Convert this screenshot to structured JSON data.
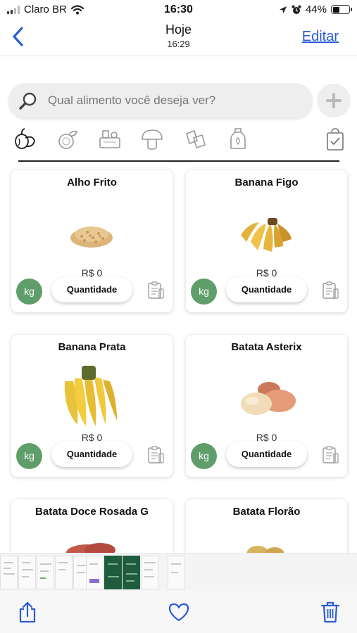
{
  "status_bar": {
    "carrier": "Claro BR",
    "time": "16:30",
    "battery": "44%",
    "battery_level": 0.44,
    "icons": [
      "signal-icon",
      "wifi-icon",
      "location-icon",
      "alarm-icon",
      "battery-icon"
    ]
  },
  "header": {
    "title": "Hoje",
    "subtitle": "16:29",
    "edit_label": "Editar",
    "accent": "#2a5bd7"
  },
  "search": {
    "placeholder": "Qual alimento você deseja ver?"
  },
  "categories": [
    {
      "icon": "vegetables-icon",
      "selected": true
    },
    {
      "icon": "fruits-icon",
      "selected": false
    },
    {
      "icon": "groceries-icon",
      "selected": false
    },
    {
      "icon": "mushroom-icon",
      "selected": false
    },
    {
      "icon": "packages-icon",
      "selected": false
    },
    {
      "icon": "bottle-icon",
      "selected": false
    },
    {
      "icon": "shopping-list-icon",
      "selected": false
    }
  ],
  "products": [
    {
      "name": "Alho Frito",
      "price": "R$ 0",
      "unit": "kg",
      "quantity_label": "Quantidade",
      "image": "fried-garlic"
    },
    {
      "name": "Banana Figo",
      "price": "R$ 0",
      "unit": "kg",
      "quantity_label": "Quantidade",
      "image": "banana-figo"
    },
    {
      "name": "Banana Prata",
      "price": "R$ 0",
      "unit": "kg",
      "quantity_label": "Quantidade",
      "image": "banana-prata"
    },
    {
      "name": "Batata Asterix",
      "price": "R$ 0",
      "unit": "kg",
      "quantity_label": "Quantidade",
      "image": "batata-asterix"
    },
    {
      "name": "Batata Doce Rosada G",
      "image": "sweet-potato"
    },
    {
      "name": "Batata Florão",
      "image": "batata-florao"
    }
  ],
  "colors": {
    "unit_badge": "#5f9e6a",
    "thumbnail_dark": "#1e5c3d",
    "toolbar_icons": "#2a5bd7"
  },
  "toolbar": {
    "icons": [
      "share-icon",
      "heart-icon",
      "trash-icon"
    ]
  }
}
